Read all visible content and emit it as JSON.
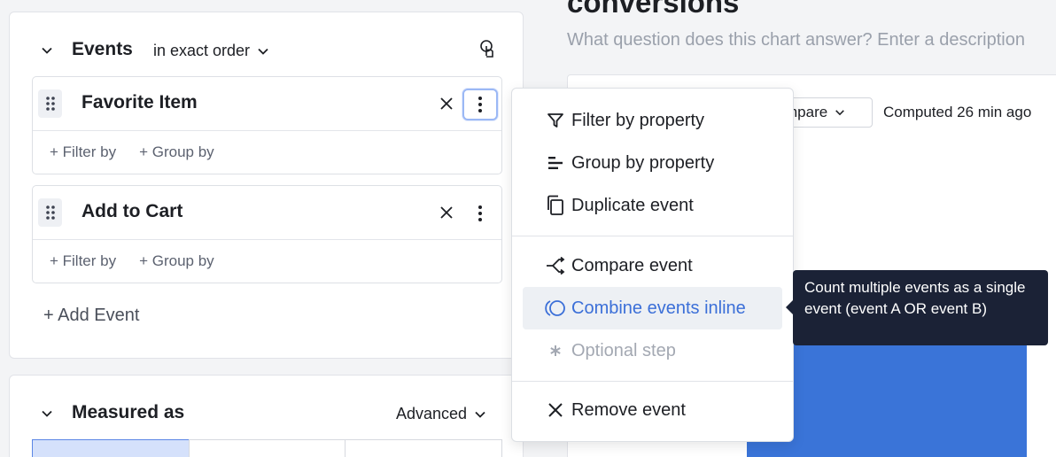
{
  "colors": {
    "accent": "#3b6fd8",
    "tooltip_bg": "#1b2236",
    "chart_bar": "#3a74d8",
    "selected_segment": "#d5e1fb"
  },
  "events_panel": {
    "title": "Events",
    "order_mode": "in exact order",
    "events": [
      {
        "name": "Favorite Item",
        "filter_label": "+ Filter by",
        "group_label": "+ Group by"
      },
      {
        "name": "Add to Cart",
        "filter_label": "+ Filter by",
        "group_label": "+ Group by"
      }
    ],
    "add_event_label": "+ Add Event"
  },
  "measured_panel": {
    "title": "Measured as",
    "advanced_label": "Advanced"
  },
  "chart_header": {
    "title": "conversions",
    "description_placeholder": "What question does this chart answer? Enter a description",
    "compare_label": "mpare",
    "computed_label": "Computed 26 min ago"
  },
  "event_menu": {
    "items": [
      {
        "label": "Filter by property",
        "icon": "filter-icon"
      },
      {
        "label": "Group by property",
        "icon": "group-by-icon"
      },
      {
        "label": "Duplicate event",
        "icon": "duplicate-icon"
      },
      {
        "label": "Compare event",
        "icon": "compare-icon"
      },
      {
        "label": "Combine events inline",
        "icon": "combine-icon",
        "highlighted": true
      },
      {
        "label": "Optional step",
        "icon": "asterisk-icon",
        "disabled": true
      },
      {
        "label": "Remove event",
        "icon": "close-icon"
      }
    ]
  },
  "tooltip": {
    "text": "Count multiple events as a single event (event A OR event B)"
  }
}
